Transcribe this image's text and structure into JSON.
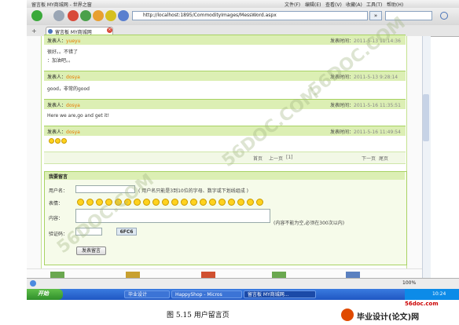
{
  "browser": {
    "title": "留言板 MY商城网 - 世界之窗",
    "menu": [
      "文件(F)",
      "编辑(E)",
      "查看(V)",
      "收藏(A)",
      "工具(T)",
      "帮助(H)"
    ],
    "address": "http://localhost:1895/CommodityImages/MessWord.aspx",
    "go_label": "»",
    "tab_label": "留言板 MY商城网",
    "zoom": "100%"
  },
  "messages": [
    {
      "author_label": "发表人：",
      "author": "yueyu",
      "time_label": "发表时间：",
      "time": "2011-5-13 11:14:36",
      "lines": [
        "很好。。不错了",
        "：加油吧。。"
      ],
      "emoji_count": 0
    },
    {
      "author_label": "发表人：",
      "author": "dosya",
      "time_label": "发表时间：",
      "time": "2011-5-13 9:28:14",
      "lines": [
        "good，非常的good"
      ],
      "emoji_count": 0
    },
    {
      "author_label": "发表人：",
      "author": "dosya",
      "time_label": "发表时间：",
      "time": "2011-5-16 11:35:51",
      "lines": [
        "Here we are,go and get it!"
      ],
      "emoji_count": 0
    },
    {
      "author_label": "发表人：",
      "author": "dosya",
      "time_label": "发表时间：",
      "time": "2011-5-16 11:49:54",
      "lines": [],
      "emoji_count": 3
    }
  ],
  "pager": {
    "first": "首页",
    "prev": "上一页",
    "current": "[1]",
    "next": "下一页",
    "last": "尾页"
  },
  "form": {
    "title": "我要留言",
    "username_label": "用户名：",
    "username_hint": "( 用户名只能是3到10位的字母、数字或下划线组成 )",
    "emoji_label": "表情：",
    "content_label": "内容：",
    "content_hint": "(内容不能为空,必须在300次以内)",
    "captcha_label": "验证码：",
    "captcha_code": "6FC6",
    "submit_label": "发表留言"
  },
  "taskbar": {
    "start_label": "开始",
    "tasks": [
      "毕业设计",
      "HappyShop - Micros",
      "留言板 MY商城网..."
    ],
    "clock": "10:24"
  },
  "footer": {
    "site_tag": "56doc.com",
    "caption": "图 5.15  用户留言页",
    "brand": "毕业设计(论文)网"
  },
  "watermark": "56DOC.COM"
}
